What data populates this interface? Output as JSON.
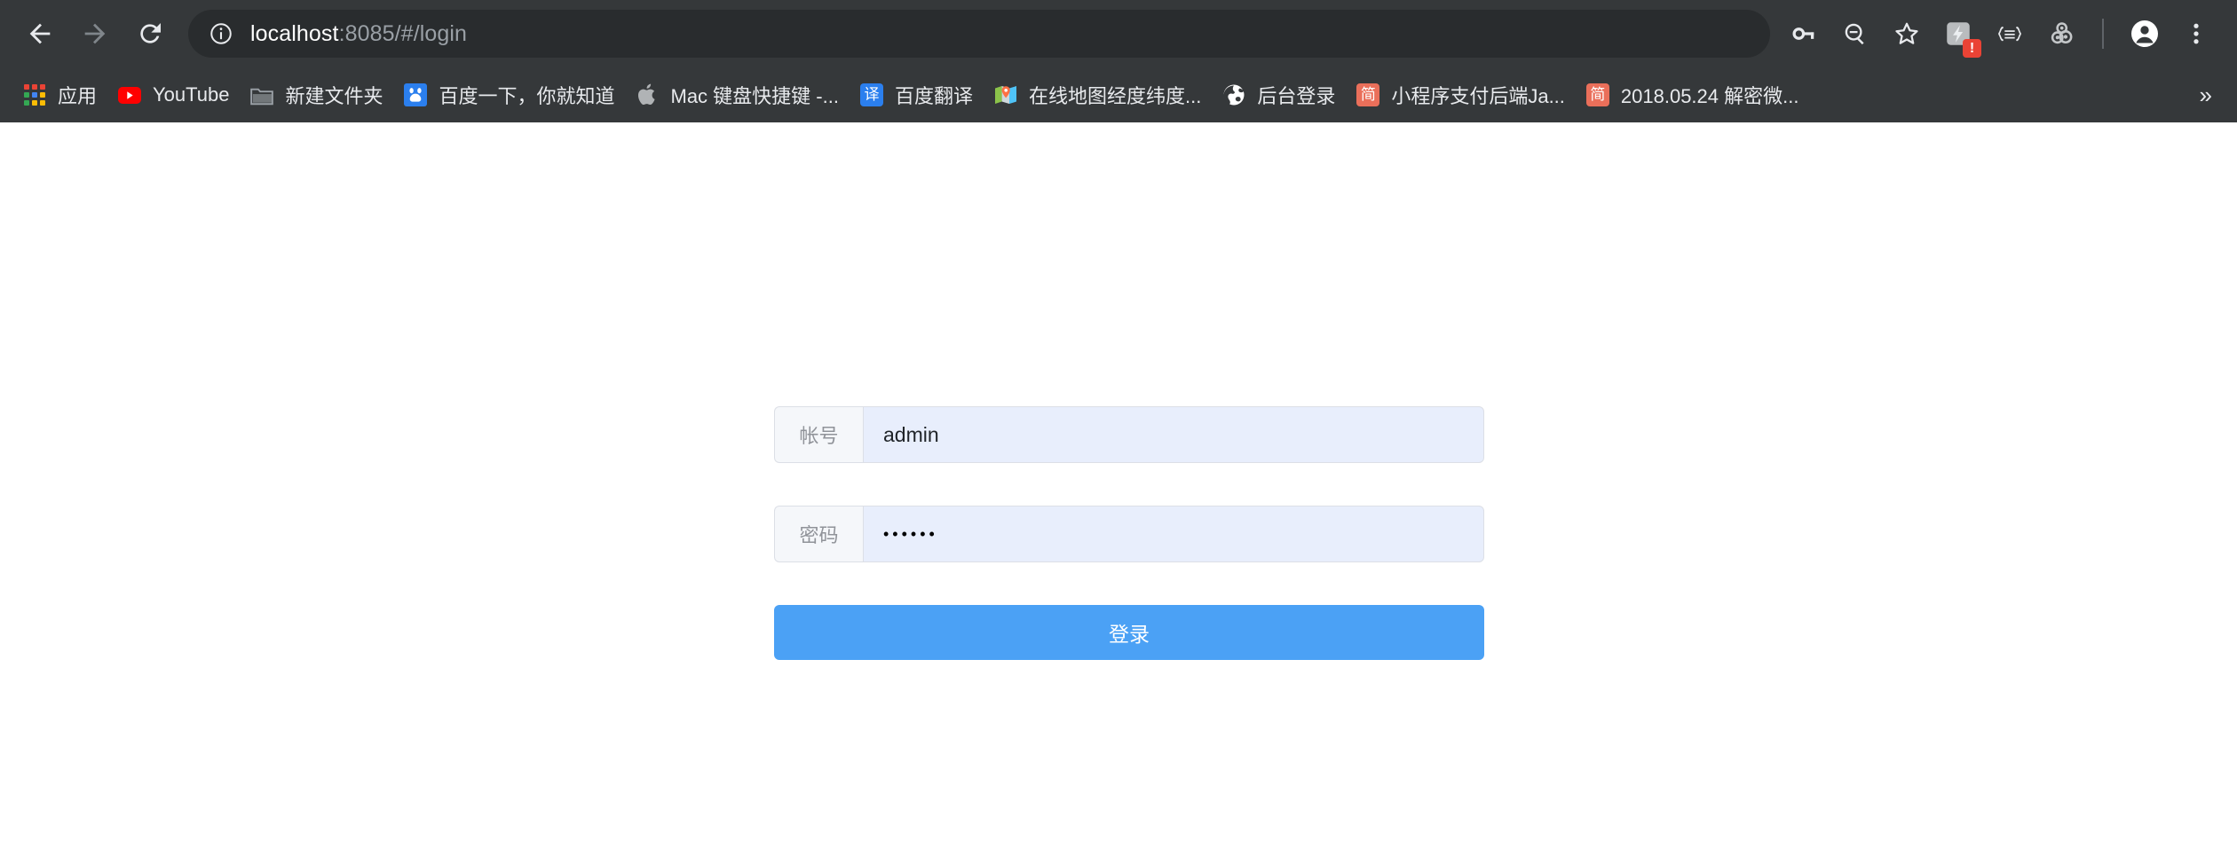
{
  "browser": {
    "nav": {
      "back_icon": "arrow-left-icon",
      "forward_icon": "arrow-right-icon",
      "reload_icon": "reload-icon"
    },
    "omnibox": {
      "info_icon": "info-circle-icon",
      "url_host": "localhost",
      "url_path": ":8085/#/login",
      "full_url": "localhost:8085/#/login"
    },
    "actions": [
      {
        "name": "password-manager-icon",
        "label": ""
      },
      {
        "name": "zoom-out-icon",
        "label": ""
      },
      {
        "name": "bookmark-star-icon",
        "label": ""
      },
      {
        "name": "extension-lightning-icon",
        "label": "",
        "badge": "!"
      },
      {
        "name": "json-formatter-icon",
        "label": "{≡}"
      },
      {
        "name": "extension-gears-icon",
        "label": ""
      },
      {
        "name": "profile-avatar-icon",
        "label": ""
      },
      {
        "name": "chrome-menu-icon",
        "label": ""
      }
    ]
  },
  "bookmarks": {
    "overflow_label": "»",
    "items": [
      {
        "label": "应用",
        "icon": "apps-grid-icon"
      },
      {
        "label": "YouTube",
        "icon": "youtube-icon"
      },
      {
        "label": "新建文件夹",
        "icon": "folder-icon"
      },
      {
        "label": "百度一下，你就知道",
        "icon": "baidu-paw-icon"
      },
      {
        "label": "Mac 键盘快捷键 -...",
        "icon": "apple-icon"
      },
      {
        "label": "百度翻译",
        "icon": "baidu-translate-icon",
        "glyph": "译"
      },
      {
        "label": "在线地图经度纬度...",
        "icon": "map-pin-icon"
      },
      {
        "label": "后台登录",
        "icon": "globe-icon"
      },
      {
        "label": "小程序支付后端Ja...",
        "icon": "jianshu-icon",
        "glyph": "简"
      },
      {
        "label": "2018.05.24 解密微...",
        "icon": "jianshu-icon",
        "glyph": "简"
      }
    ]
  },
  "page": {
    "login": {
      "username": {
        "label": "帐号",
        "value": "admin",
        "placeholder": "帐号"
      },
      "password": {
        "label": "密码",
        "value": "••••••",
        "placeholder": "密码"
      },
      "submit_label": "登录"
    }
  },
  "colors": {
    "chrome_bg": "#35383a",
    "omnibox_bg": "#292c2e",
    "accent_button": "#4ba1f5",
    "input_autofill": "#e8eefc",
    "prepend_bg": "#f5f7fa",
    "border": "#dcdfe6",
    "badge_red": "#ea4335"
  }
}
